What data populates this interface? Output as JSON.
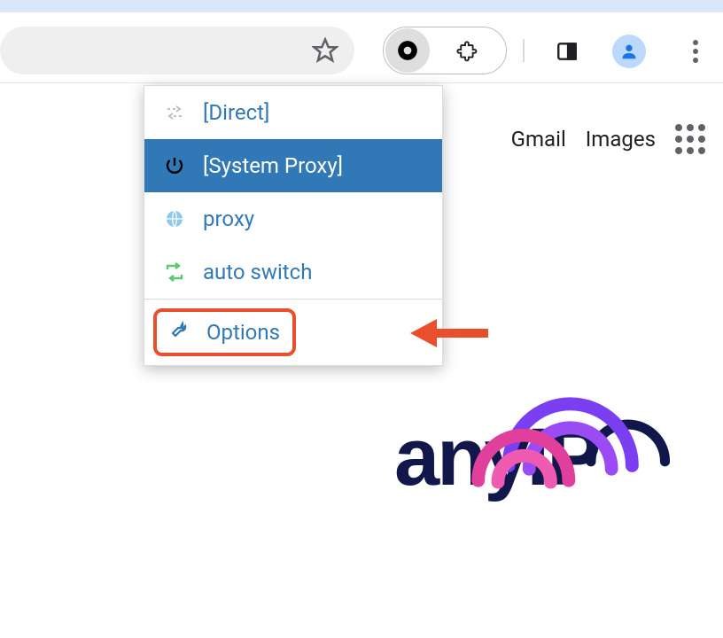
{
  "toolbar": {
    "omnibox_value": ""
  },
  "contentbar": {
    "links": [
      "Gmail",
      "Images"
    ]
  },
  "menu": {
    "items": [
      {
        "label": "[Direct]",
        "icon": "swap-icon",
        "selected": false
      },
      {
        "label": "[System Proxy]",
        "icon": "power-icon",
        "selected": true
      },
      {
        "label": "proxy",
        "icon": "globe-icon",
        "selected": false
      },
      {
        "label": "auto switch",
        "icon": "cycle-icon",
        "selected": false
      }
    ],
    "options_label": "Options"
  },
  "logo": {
    "text": "anyIP"
  }
}
